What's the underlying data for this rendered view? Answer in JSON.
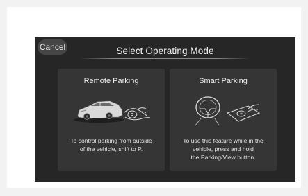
{
  "header": {
    "cancel_label": "Cancel",
    "title": "Select Operating Mode"
  },
  "cards": [
    {
      "title": "Remote Parking",
      "description": "To control parking from outside\nof the vehicle, shift to P.",
      "icon": "car-and-key-fob-icon"
    },
    {
      "title": "Smart Parking",
      "description": "To use this feature while in the\nvehicle, press and hold\nthe Parking/View button.",
      "icon": "steering-wheel-and-button-icon"
    }
  ],
  "colors": {
    "background": "#262626",
    "card": "#353535",
    "text": "#f0f0f0",
    "cancel_button": "#464646"
  }
}
